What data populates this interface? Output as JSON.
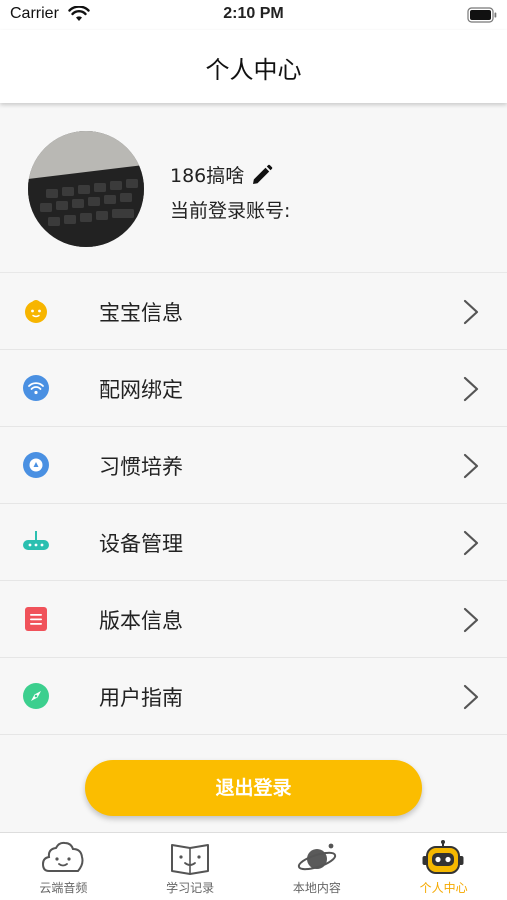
{
  "status_bar": {
    "carrier": "Carrier",
    "time": "2:10 PM"
  },
  "nav": {
    "title": "个人中心"
  },
  "profile": {
    "name": "186搞啥",
    "account_label": "当前登录账号:"
  },
  "menu": {
    "items": [
      {
        "label": "宝宝信息",
        "icon": "baby-face-icon",
        "color": "#f7b500"
      },
      {
        "label": "配网绑定",
        "icon": "wifi-icon",
        "color": "#4a90e2"
      },
      {
        "label": "习惯培养",
        "icon": "habit-compass-icon",
        "color": "#4a90e2"
      },
      {
        "label": "设备管理",
        "icon": "router-icon",
        "color": "#2bbfb0"
      },
      {
        "label": "版本信息",
        "icon": "document-icon",
        "color": "#f0525a"
      },
      {
        "label": "用户指南",
        "icon": "guide-compass-icon",
        "color": "#3ccf8e"
      }
    ]
  },
  "logout": {
    "label": "退出登录"
  },
  "tabs": [
    {
      "label": "云端音频",
      "icon": "cloud-face-icon",
      "active": false
    },
    {
      "label": "学习记录",
      "icon": "book-face-icon",
      "active": false
    },
    {
      "label": "本地内容",
      "icon": "planet-icon",
      "active": false
    },
    {
      "label": "个人中心",
      "icon": "robot-icon",
      "active": true
    }
  ],
  "colors": {
    "accent": "#fbbd00",
    "active_tab": "#f5a900"
  }
}
